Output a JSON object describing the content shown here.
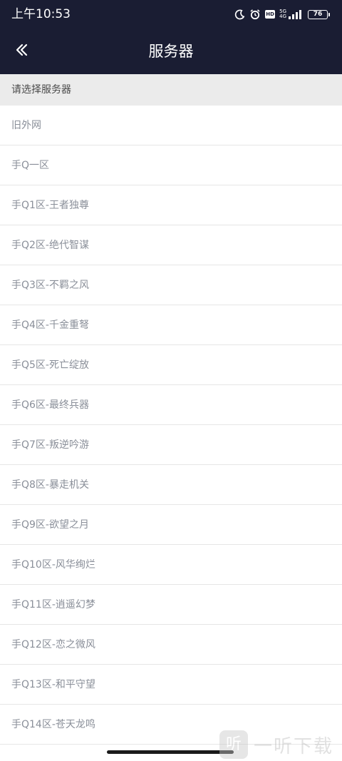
{
  "status_bar": {
    "time": "上午10:53",
    "network_top": "5G",
    "network_bottom": "4G",
    "hd_label": "HD",
    "battery": "76",
    "icons": [
      "moon-icon",
      "alarm-icon",
      "hd-icon",
      "signal-icon",
      "battery-icon"
    ]
  },
  "nav": {
    "back_icon": "chevron-left-icon",
    "title": "服务器"
  },
  "section": {
    "header": "请选择服务器"
  },
  "servers": [
    "旧外网",
    "手Q一区",
    "手Q1区-王者独尊",
    "手Q2区-绝代智谋",
    "手Q3区-不羁之风",
    "手Q4区-千金重弩",
    "手Q5区-死亡绽放",
    "手Q6区-最终兵器",
    "手Q7区-叛逆吟游",
    "手Q8区-暴走机关",
    "手Q9区-欲望之月",
    "手Q10区-风华绚烂",
    "手Q11区-逍遥幻梦",
    "手Q12区-恋之微风",
    "手Q13区-和平守望",
    "手Q14区-苍天龙鸣"
  ],
  "watermark": {
    "logo": "听",
    "text": "一听下载"
  },
  "colors": {
    "header_bg": "#1a1d33",
    "section_bg": "#ebebeb",
    "item_text": "#8a8f99"
  }
}
